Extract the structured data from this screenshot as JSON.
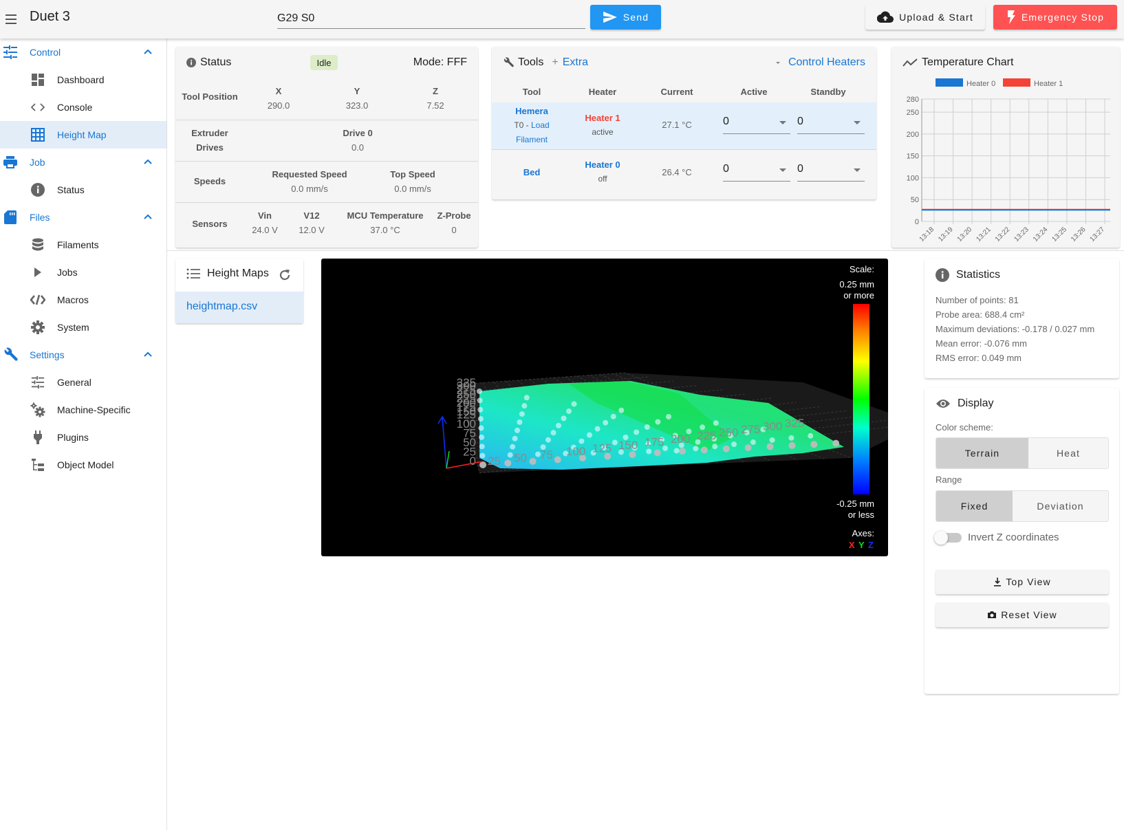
{
  "appbar": {
    "title": "Duet 3",
    "code_value": "G29 S0",
    "send_label": "Send",
    "upload_label": "Upload & Start",
    "estop_label": "Emergency Stop"
  },
  "sidebar": {
    "groups": [
      {
        "label": "Control",
        "icon": "tune-icon",
        "items": [
          {
            "label": "Dashboard",
            "icon": "dashboard-icon"
          },
          {
            "label": "Console",
            "icon": "code-icon"
          },
          {
            "label": "Height Map",
            "icon": "grid-icon",
            "active": true
          }
        ]
      },
      {
        "label": "Job",
        "icon": "printer-icon",
        "items": [
          {
            "label": "Status",
            "icon": "info-icon"
          }
        ]
      },
      {
        "label": "Files",
        "icon": "sd-card-icon",
        "items": [
          {
            "label": "Filaments",
            "icon": "database-icon"
          },
          {
            "label": "Jobs",
            "icon": "play-icon"
          },
          {
            "label": "Macros",
            "icon": "code-slash-icon"
          },
          {
            "label": "System",
            "icon": "gear-icon"
          }
        ]
      },
      {
        "label": "Settings",
        "icon": "wrench-icon",
        "items": [
          {
            "label": "General",
            "icon": "tune-icon"
          },
          {
            "label": "Machine-Specific",
            "icon": "gears-icon"
          },
          {
            "label": "Plugins",
            "icon": "plug-icon"
          },
          {
            "label": "Object Model",
            "icon": "file-tree-icon"
          }
        ]
      }
    ]
  },
  "status": {
    "title": "Status",
    "badge": "Idle",
    "mode": "Mode: FFF",
    "tool_position": {
      "label": "Tool Position",
      "axes": [
        {
          "name": "X",
          "value": "290.0"
        },
        {
          "name": "Y",
          "value": "323.0"
        },
        {
          "name": "Z",
          "value": "7.52"
        }
      ]
    },
    "extruder": {
      "label1": "Extruder",
      "label2": "Drives",
      "drive_name": "Drive 0",
      "drive_value": "0.0"
    },
    "speeds": {
      "label": "Speeds",
      "requested_label": "Requested Speed",
      "requested_value": "0.0 mm/s",
      "top_label": "Top Speed",
      "top_value": "0.0 mm/s"
    },
    "sensors": {
      "label": "Sensors",
      "items": [
        {
          "name": "Vin",
          "value": "24.0 V"
        },
        {
          "name": "V12",
          "value": "12.0 V"
        },
        {
          "name": "MCU Temperature",
          "value": "37.0 °C"
        },
        {
          "name": "Z-Probe",
          "value": "0"
        }
      ]
    }
  },
  "tools": {
    "title": "Tools",
    "extra_label": "Extra",
    "control_heaters_label": "Control Heaters",
    "headers": [
      "Tool",
      "Heater",
      "Current",
      "Active",
      "Standby"
    ],
    "rows": [
      {
        "tool": "Hemera",
        "tool_sub_prefix": "T0 - ",
        "tool_sub_link1": "Load",
        "tool_sub_link2": "Filament",
        "heater": "Heater 1",
        "heater_state": "active",
        "current": "27.1 °C",
        "active": "0",
        "standby": "0"
      },
      {
        "tool": "Bed",
        "heater": "Heater 0",
        "heater_state": "off",
        "current": "26.4 °C",
        "active": "0",
        "standby": "0"
      }
    ]
  },
  "temp_chart": {
    "title": "Temperature Chart"
  },
  "chart_data": {
    "type": "line",
    "title": "Temperature Chart",
    "xlabel": "",
    "ylabel": "",
    "x": [
      "13:18",
      "13:19",
      "13:20",
      "13:21",
      "13:22",
      "13:23",
      "13:24",
      "13:25",
      "13:26",
      "13:27"
    ],
    "y_ticks": [
      0,
      50,
      100,
      150,
      200,
      250,
      280
    ],
    "ylim": [
      0,
      280
    ],
    "grid": true,
    "legend": "top",
    "series": [
      {
        "name": "Heater 0",
        "color": "#1976d2",
        "values": [
          26.4,
          26.4,
          26.4,
          26.4,
          26.4,
          26.4,
          26.4,
          26.4,
          26.4,
          26.4
        ]
      },
      {
        "name": "Heater 1",
        "color": "#f44336",
        "values": [
          27.1,
          27.1,
          27.1,
          27.1,
          27.1,
          27.1,
          27.1,
          27.1,
          27.1,
          27.1
        ]
      }
    ]
  },
  "height_maps": {
    "title": "Height Maps",
    "files": [
      "heightmap.csv"
    ]
  },
  "viewer": {
    "scale_label": "Scale:",
    "scale_top1": "0.25 mm",
    "scale_top2": "or more",
    "scale_bottom1": "-0.25 mm",
    "scale_bottom2": "or less",
    "axes_label": "Axes:",
    "axis_x": "X",
    "axis_y": "Y",
    "axis_z": "Z",
    "x_ticks": [
      "25",
      "50",
      "75",
      "100",
      "125",
      "150",
      "175",
      "200",
      "225",
      "250",
      "275",
      "300",
      "325"
    ],
    "y_ticks": [
      "0",
      "25",
      "50",
      "75",
      "100",
      "125",
      "150",
      "175",
      "200",
      "225",
      "250",
      "275",
      "300",
      "325"
    ]
  },
  "statistics": {
    "title": "Statistics",
    "lines": [
      "Number of points: 81",
      "Probe area: 688.4 cm²",
      "Maximum deviations: -0.178 / 0.027 mm",
      "Mean error: -0.076 mm",
      "RMS error: 0.049 mm"
    ]
  },
  "display": {
    "title": "Display",
    "color_scheme_label": "Color scheme:",
    "color_options": [
      "Terrain",
      "Heat"
    ],
    "color_selected": "Terrain",
    "range_label": "Range",
    "range_options": [
      "Fixed",
      "Deviation"
    ],
    "range_selected": "Fixed",
    "invert_label": "Invert Z coordinates",
    "invert_on": false,
    "top_view_label": "Top View",
    "reset_view_label": "Reset View"
  }
}
